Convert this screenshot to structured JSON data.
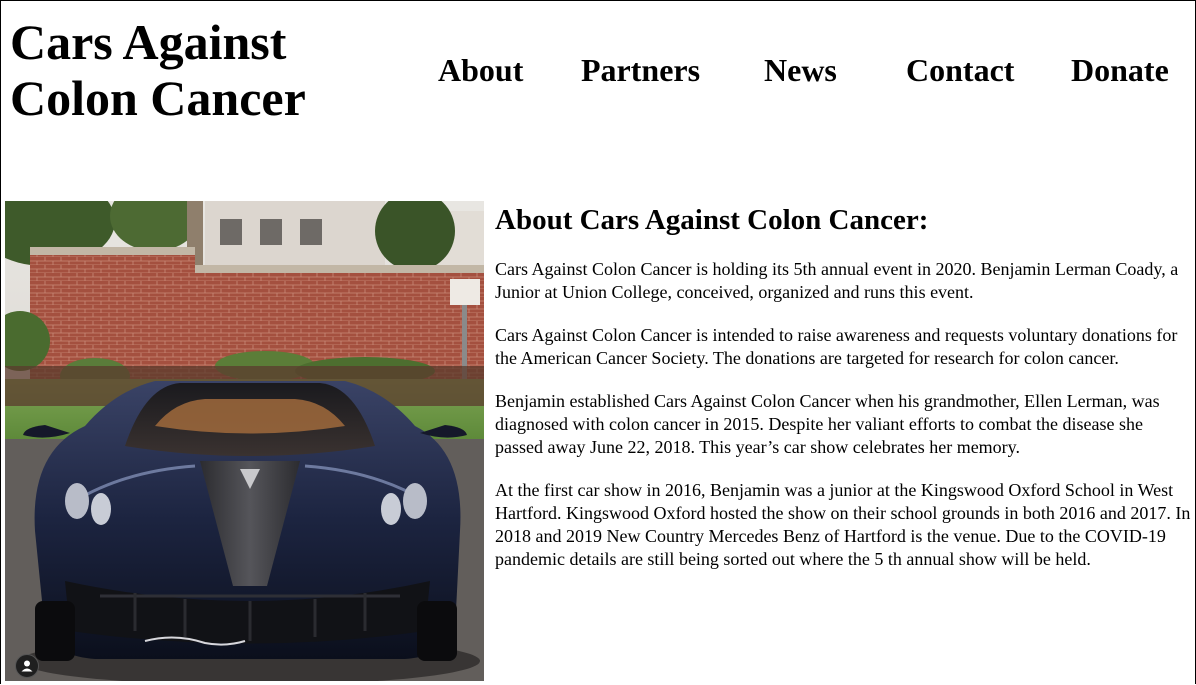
{
  "site": {
    "title_line1": "Cars Against",
    "title_line2": "Colon Cancer"
  },
  "nav": {
    "items": [
      "About",
      "Partners",
      "News",
      "Contact",
      "Donate"
    ]
  },
  "hero": {
    "badge_icon": "person-icon",
    "car_color": "#1c2440"
  },
  "about": {
    "heading": "About Cars Against Colon Cancer:",
    "paragraphs": [
      "Cars Against Colon Cancer is holding its 5th annual event in 2020. Benjamin Lerman Coady, a Junior at Union College, conceived, organized and runs this event.",
      "Cars Against Colon Cancer is intended to raise awareness and requests voluntary donations for the American Cancer Society. The donations are targeted for research for colon cancer.",
      "Benjamin established Cars Against Colon Cancer when his grandmother, Ellen Lerman, was diagnosed with colon cancer in 2015. Despite her valiant efforts to combat the disease she passed away June 22, 2018. This year’s car show celebrates her memory.",
      "At the first car show in 2016, Benjamin was a junior at the Kingswood Oxford School in West Hartford. Kingswood Oxford hosted the show on their school grounds in both 2016 and 2017. In 2018 and 2019 New Country Mercedes Benz of Hartford is the venue. Due to the COVID-19 pandemic details are still being sorted out where the 5 th annual show will be held."
    ]
  }
}
